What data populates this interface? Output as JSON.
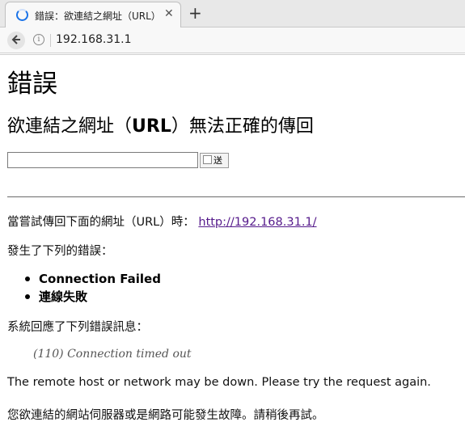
{
  "browser": {
    "tab_title": "錯誤：欲連結之網址（URL）",
    "tab_close": "✕",
    "new_tab": "+",
    "address": "192.168.31.1"
  },
  "page": {
    "title": "錯誤",
    "subtitle_pre": "欲連結之網址（",
    "subtitle_url": "URL",
    "subtitle_post": "）無法正確的傳回",
    "search_button": "送",
    "line_tried": "當嘗試傳回下面的網址（URL）時：",
    "tried_url": "http://192.168.31.1/",
    "line_errors": "發生了下列的錯誤：",
    "errors": [
      "Connection Failed",
      "連線失敗"
    ],
    "line_system": "系統回應了下列錯誤訊息：",
    "system_message": "(110) Connection timed out",
    "hint_en": "The remote host or network may be down. Please try the request again.",
    "hint_zh": "您欲連結的網站伺服器或是網路可能發生故障。請稍後再試。"
  }
}
